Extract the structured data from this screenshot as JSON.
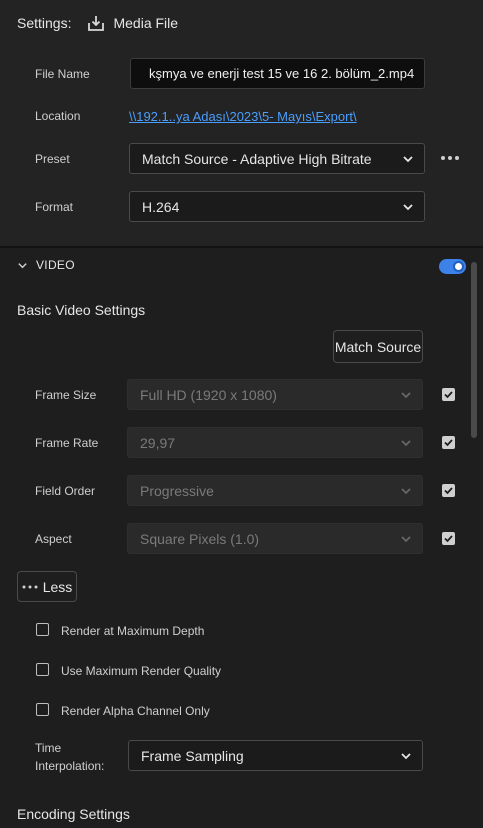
{
  "header": {
    "settings_label": "Settings:",
    "destination_label": "Media File"
  },
  "file_name": {
    "label": "File Name",
    "value": "kşmya ve enerji test 15 ve 16 2. bölüm_2.mp4"
  },
  "location": {
    "label": "Location",
    "value": "\\\\192.1..ya Adası\\2023\\5- Mayıs\\Export\\"
  },
  "preset": {
    "label": "Preset",
    "value": "Match Source - Adaptive High Bitrate"
  },
  "format": {
    "label": "Format",
    "value": "H.264"
  },
  "video": {
    "section_label": "VIDEO",
    "enabled": true,
    "accent_color": "#3d82e8",
    "basic_title": "Basic Video Settings",
    "match_source_label": "Match Source",
    "frame_size": {
      "label": "Frame Size",
      "value": "Full HD (1920 x 1080)",
      "checked": true
    },
    "frame_rate": {
      "label": "Frame Rate",
      "value": "29,97",
      "checked": true
    },
    "field_order": {
      "label": "Field Order",
      "value": "Progressive",
      "checked": true
    },
    "aspect": {
      "label": "Aspect",
      "value": "Square Pixels (1.0)",
      "checked": true
    },
    "less_label": "Less",
    "render_max_depth": {
      "label": "Render at Maximum Depth",
      "checked": false
    },
    "max_render_quality": {
      "label": "Use Maximum Render Quality",
      "checked": false
    },
    "alpha_only": {
      "label": "Render Alpha Channel Only",
      "checked": false
    },
    "time_interp": {
      "label_line1": "Time",
      "label_line2": "Interpolation:",
      "value": "Frame Sampling"
    },
    "encoding_title": "Encoding Settings"
  },
  "icons": {
    "export": "export-icon",
    "chevron": "chevron-down-icon",
    "more": "more-icon",
    "collapse": "chevron-down-icon",
    "check": "checkmark-icon"
  }
}
